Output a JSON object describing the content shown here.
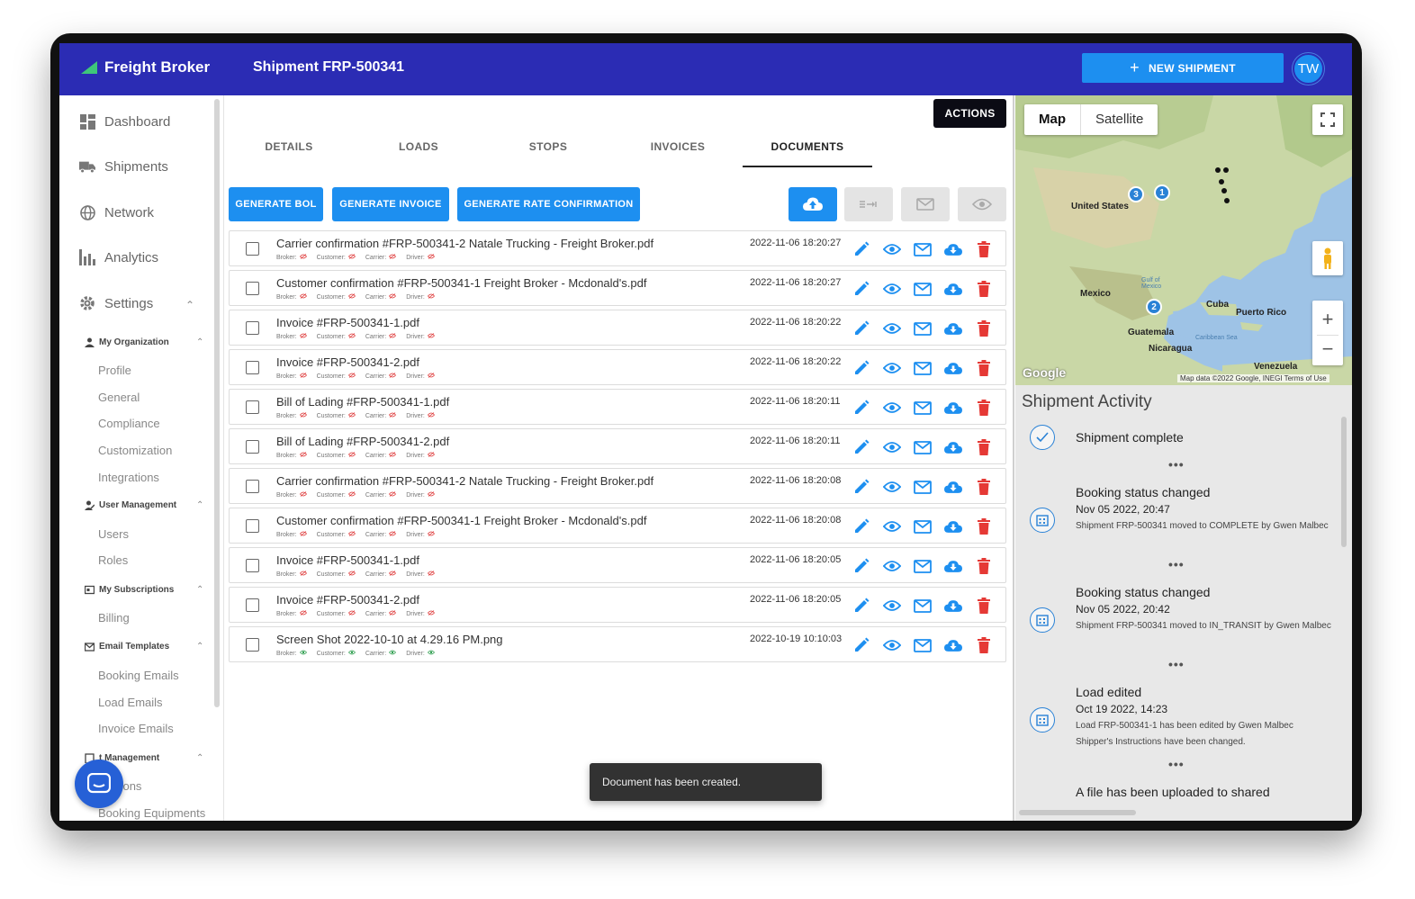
{
  "app": {
    "brand": "Freight Broker",
    "page_title": "Shipment FRP-500341",
    "new_shipment_label": "NEW SHIPMENT",
    "avatar_initials": "TW"
  },
  "colors": {
    "topbar": "#2b2cb4",
    "accent": "#1d8ff0",
    "delete": "#e53935"
  },
  "sidebar": {
    "main": [
      {
        "label": "Dashboard",
        "icon": "dashboard-icon"
      },
      {
        "label": "Shipments",
        "icon": "truck-icon"
      },
      {
        "label": "Network",
        "icon": "globe-icon"
      },
      {
        "label": "Analytics",
        "icon": "bar-chart-icon"
      },
      {
        "label": "Settings",
        "icon": "gear-icon"
      }
    ],
    "sections": [
      {
        "label": "My Organization",
        "items": [
          "Profile",
          "General",
          "Compliance",
          "Customization",
          "Integrations"
        ]
      },
      {
        "label": "User Management",
        "items": [
          "Users",
          "Roles"
        ]
      },
      {
        "label": "My Subscriptions",
        "items": [
          "Billing"
        ]
      },
      {
        "label": "Email Templates",
        "items": [
          "Booking Emails",
          "Load Emails",
          "Invoice Emails"
        ]
      },
      {
        "label": "t Management",
        "items": [
          "ocations",
          "Booking Equipments"
        ]
      }
    ]
  },
  "main": {
    "actions_label": "ACTIONS",
    "tabs": [
      "DETAILS",
      "LOADS",
      "STOPS",
      "INVOICES",
      "DOCUMENTS"
    ],
    "active_tab": "DOCUMENTS",
    "buttons": {
      "generate_bol": "GENERATE BOL",
      "generate_invoice": "GENERATE INVOICE",
      "generate_rate": "GENERATE RATE CONFIRMATION"
    },
    "meta_labels": {
      "broker": "Broker:",
      "customer": "Customer:",
      "carrier": "Carrier:",
      "driver": "Driver:"
    },
    "documents": [
      {
        "name": "Carrier confirmation #FRP-500341-2 Natale Trucking - Freight Broker.pdf",
        "date": "2022-11-06 18:20:27",
        "visible": false
      },
      {
        "name": "Customer confirmation #FRP-500341-1 Freight Broker - Mcdonald's.pdf",
        "date": "2022-11-06 18:20:27",
        "visible": false
      },
      {
        "name": "Invoice #FRP-500341-1.pdf",
        "date": "2022-11-06 18:20:22",
        "visible": false
      },
      {
        "name": "Invoice #FRP-500341-2.pdf",
        "date": "2022-11-06 18:20:22",
        "visible": false
      },
      {
        "name": "Bill of Lading #FRP-500341-1.pdf",
        "date": "2022-11-06 18:20:11",
        "visible": false
      },
      {
        "name": "Bill of Lading #FRP-500341-2.pdf",
        "date": "2022-11-06 18:20:11",
        "visible": false
      },
      {
        "name": "Carrier confirmation #FRP-500341-2 Natale Trucking - Freight Broker.pdf",
        "date": "2022-11-06 18:20:08",
        "visible": false
      },
      {
        "name": "Customer confirmation #FRP-500341-1 Freight Broker - Mcdonald's.pdf",
        "date": "2022-11-06 18:20:08",
        "visible": false
      },
      {
        "name": "Invoice #FRP-500341-1.pdf",
        "date": "2022-11-06 18:20:05",
        "visible": false
      },
      {
        "name": "Invoice #FRP-500341-2.pdf",
        "date": "2022-11-06 18:20:05",
        "visible": false
      },
      {
        "name": "Screen Shot 2022-10-10 at 4.29.16 PM.png",
        "date": "2022-10-19 10:10:03",
        "visible": true
      }
    ],
    "toast": "Document has been created."
  },
  "map": {
    "toggle": [
      "Map",
      "Satellite"
    ],
    "labels": {
      "us": "United States",
      "mexico": "Mexico",
      "cuba": "Cuba",
      "puerto_rico": "Puerto Rico",
      "guatemala": "Guatemala",
      "nicaragua": "Nicaragua",
      "venezuela": "Venezuela",
      "gulf": "Gulf of Mexico",
      "caribbean": "Caribbean Sea"
    },
    "clusters": [
      "3",
      "1",
      "2"
    ],
    "google": "Google",
    "footer": "Map data ©2022 Google, INEGI   Terms of Use"
  },
  "activity": {
    "title": "Shipment Activity",
    "items": [
      {
        "heading": "Shipment complete",
        "date": "",
        "desc": ""
      },
      {
        "heading": "Booking status changed",
        "date": "Nov 05 2022, 20:47",
        "desc": "Shipment FRP-500341 moved to COMPLETE by Gwen Malbec"
      },
      {
        "heading": "Booking status changed",
        "date": "Nov 05 2022, 20:42",
        "desc": "Shipment FRP-500341 moved to IN_TRANSIT by Gwen Malbec"
      },
      {
        "heading": "Load edited",
        "date": "Oct 19 2022, 14:23",
        "desc": "Load FRP-500341-1 has been edited by Gwen Malbec Shipper's Instructions have been changed."
      },
      {
        "heading": "A file has been uploaded to shared",
        "date": "",
        "desc": ""
      }
    ]
  }
}
